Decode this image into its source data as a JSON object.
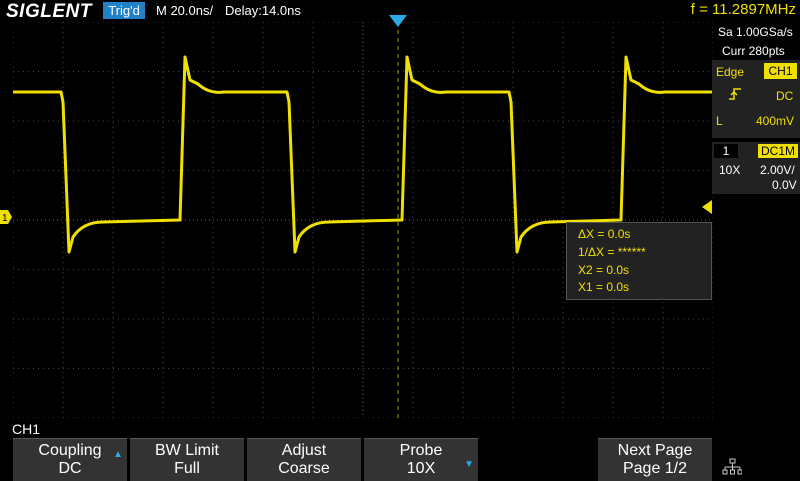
{
  "header": {
    "logo": "SIGLENT",
    "trigger_status": "Trig'd",
    "timebase": "M 20.0ns/",
    "delay": "Delay:14.0ns",
    "frequency": "f = 11.2897MHz"
  },
  "acquisition": {
    "sample_rate": "Sa 1.00GSa/s",
    "curr_points": "Curr 280pts"
  },
  "trigger": {
    "type": "Edge",
    "source": "CH1",
    "coupling": "DC",
    "level_label": "L",
    "level": "400mV"
  },
  "channel": {
    "number": "1",
    "mode": "DC1M",
    "probe": "10X",
    "volts_div": "2.00V/",
    "offset": "0.0V"
  },
  "cursor": {
    "delta_x": "ΔX = 0.0s",
    "inv_delta_x": "1/ΔX = ******",
    "x2": "X2 = 0.0s",
    "x1": "X1 = 0.0s"
  },
  "channel_menu_label": "CH1",
  "softkeys": [
    {
      "top": "Coupling",
      "bottom": "DC"
    },
    {
      "top": "BW Limit",
      "bottom": "Full"
    },
    {
      "top": "Adjust",
      "bottom": "Coarse"
    },
    {
      "top": "Probe",
      "bottom": "10X"
    },
    {
      "top": "Next Page",
      "bottom": "Page 1/2"
    }
  ],
  "colors": {
    "trace": "#f0e000",
    "accent": "#2080c8"
  }
}
